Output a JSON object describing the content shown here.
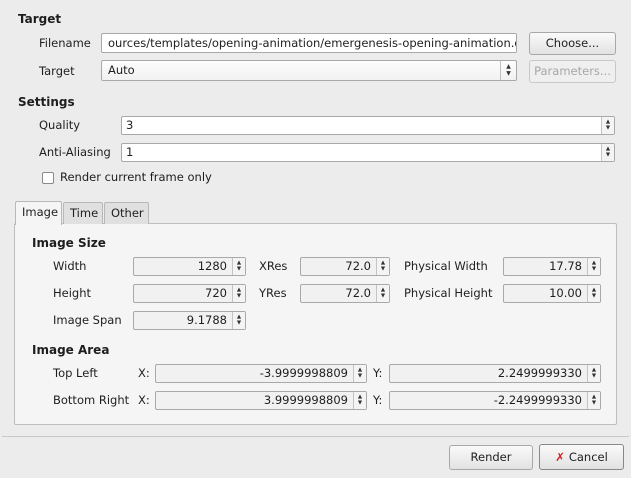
{
  "target": {
    "section_title": "Target",
    "filename_label": "Filename",
    "filename_value": "ources/templates/opening-animation/emergenesis-opening-animation.dv",
    "choose_button": "Choose...",
    "target_label": "Target",
    "target_value": "Auto",
    "parameters_button": "Parameters..."
  },
  "settings": {
    "section_title": "Settings",
    "quality_label": "Quality",
    "quality_value": "3",
    "antialias_label": "Anti-Aliasing",
    "antialias_value": "1",
    "render_current_label": "Render current frame only",
    "render_current_checked": false
  },
  "tabs": [
    {
      "label": "Image",
      "active": true
    },
    {
      "label": "Time",
      "active": false
    },
    {
      "label": "Other",
      "active": false
    }
  ],
  "image_size": {
    "title": "Image Size",
    "width_label": "Width",
    "width_value": "1280",
    "xres_label": "XRes",
    "xres_value": "72.0",
    "physical_width_label": "Physical Width",
    "physical_width_value": "17.78",
    "height_label": "Height",
    "height_value": "720",
    "yres_label": "YRes",
    "yres_value": "72.0",
    "physical_height_label": "Physical Height",
    "physical_height_value": "10.00",
    "span_label": "Image Span",
    "span_value": "9.1788"
  },
  "image_area": {
    "title": "Image Area",
    "top_left_label": "Top Left",
    "bottom_right_label": "Bottom Right",
    "x_label": "X:",
    "y_label": "Y:",
    "tl_x": "-3.9999998809",
    "tl_y": "2.2499999330",
    "br_x": "3.9999998809",
    "br_y": "-2.2499999330"
  },
  "footer": {
    "render_button": "Render",
    "cancel_button": "Cancel"
  },
  "icons": {
    "cancel": "red-x-icon"
  },
  "colors": {
    "cancel_icon": "#d42020"
  }
}
